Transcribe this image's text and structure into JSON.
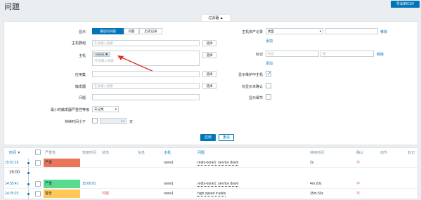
{
  "page": {
    "title": "问题",
    "export_label": "导出到CSV"
  },
  "filter": {
    "tab_label": "过滤器 ▲",
    "show_label": "显示",
    "show_options": [
      "最近的问题",
      "问题",
      "历史记录"
    ],
    "host_groups_label": "主机群组",
    "host_groups_placeholder": "在此输入搜索",
    "select_label": "选择",
    "hosts_label": "主机",
    "host_tag": "none1",
    "hosts_placeholder": "在此输入搜索",
    "app_label": "应用集",
    "triggers_label": "触发器",
    "triggers_placeholder": "在此输入搜索",
    "choose_label": "选择",
    "problem_label": "问题",
    "min_severity_label": "最小的触发器严重性等级",
    "min_severity_value": "未分类",
    "age_label": "持续时间小于",
    "age_value": "14",
    "age_unit": "天",
    "host_inventory_label": "主机资产记录",
    "inventory_type_value": "类型",
    "remove_label": "移除",
    "add_label": "添加",
    "tags_label": "标记",
    "tag_name_placeholder": "标记",
    "tag_value_placeholder": "值",
    "tag_remove_label": "移除",
    "tag_add_label": "添加",
    "maintenance_label": "显示维护中主机",
    "unack_label": "仅显示未确认",
    "details_label": "显示细节",
    "apply_label": "应用",
    "reset_label": "重设"
  },
  "table": {
    "headers": [
      "时间 ▼",
      "严重性",
      "恢复时间",
      "状态",
      "信息",
      "主机",
      "问题",
      "持续时间",
      "确认",
      "动作",
      "标记"
    ],
    "date_marker": "15:00",
    "rows": [
      {
        "time": "15:01:16",
        "severity": "严重",
        "sev_color": "#e97659",
        "recovery": "",
        "status": "",
        "host": "none1",
        "problem": "redis-none1: service down",
        "duration": "2s",
        "ack": "不"
      },
      {
        "time": "14:55:41",
        "severity": "严重",
        "sev_color": "#e97659",
        "recovery": "15:00:01",
        "status": "",
        "host": "none1",
        "problem": "redis-none1: service down",
        "duration": "4m 20s",
        "ack": "不"
      },
      {
        "time": "14:25:23",
        "severity": "警告",
        "sev_color": "#ffc859",
        "recovery": "",
        "status": "问题",
        "host": "none1",
        "problem": "high speed in pkts",
        "duration": "35m 55s",
        "ack": "不"
      }
    ]
  },
  "colors": {
    "accent": "#0275b8",
    "resolved": "#59db8f"
  }
}
